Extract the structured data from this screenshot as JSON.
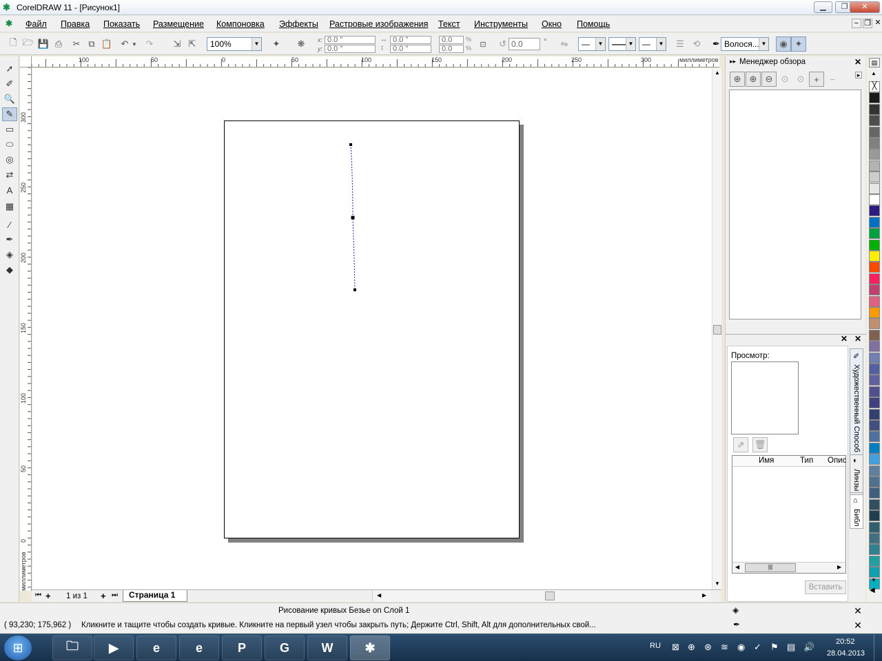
{
  "window": {
    "title": "CorelDRAW 11 - [Рисунок1]",
    "minimize": "▁",
    "restore": "❐",
    "close": "✕"
  },
  "menu": [
    "Файл",
    "Правка",
    "Показать",
    "Размещение",
    "Компоновка",
    "Эффекты",
    "Растровые изображения",
    "Текст",
    "Инструменты",
    "Окно",
    "Помощь"
  ],
  "toolbar": {
    "zoom": "100%",
    "x": "0.0 \"",
    "y": "0.0 \"",
    "w": "0.0 \"",
    "h": "0.0 \"",
    "scale_x": "0.0",
    "scale_y": "0.0",
    "pct1": "%",
    "pct2": "%",
    "rotation": "0.0",
    "degree": "°",
    "outline": "Волося...",
    "x_label": "x:",
    "y_label": "y:"
  },
  "rulers": {
    "h_labels": [
      "100",
      "50",
      "0",
      "50",
      "100",
      "150",
      "200",
      "250",
      "300"
    ],
    "h_unit": "миллиметров",
    "v_labels": [
      "300",
      "250",
      "200",
      "150",
      "100",
      "50",
      "0"
    ],
    "v_unit": "миллиметров"
  },
  "pages": {
    "counter": "1 из 1",
    "tab": "Страница 1"
  },
  "docker": {
    "view_manager_title": "Менеджер обзора",
    "preview_label": "Просмотр:",
    "columns": [
      "Имя",
      "Тип",
      "Опис"
    ],
    "insert_button": "Вставить",
    "side_tabs": [
      "Художественный Способ",
      "Линзы",
      "Библ"
    ]
  },
  "palette": {
    "colors": [
      "#ffffff",
      "#1a1a1a",
      "#333333",
      "#4d4d4d",
      "#666666",
      "#808080",
      "#999999",
      "#b3b3b3",
      "#cccccc",
      "#e6e6e6",
      "#ffffff",
      "#2e1a80",
      "#0070c0",
      "#00a040",
      "#00b000",
      "#ffee00",
      "#ff4a00",
      "#ff2060",
      "#c04070",
      "#e06080",
      "#ff9900",
      "#c09070",
      "#806050",
      "#8070a0",
      "#7080b0",
      "#5060a0",
      "#6060a0",
      "#505090",
      "#404080",
      "#304070",
      "#405080",
      "#5070a0",
      "#0080c0",
      "#40a0e0",
      "#6080a0",
      "#507090",
      "#406080",
      "#305060",
      "#204050",
      "#306070",
      "#407080",
      "#308090",
      "#20a0a0",
      "#10a0b0",
      "#00b0c0"
    ]
  },
  "status": {
    "line1": "Рисование кривых Безье on Слой 1",
    "coords": "( 93,230; 175,962 )",
    "hint": "Кликните и тащите чтобы создать кривые. Кликните на первый узел чтобы закрыть путь; Держите Ctrl, Shift, Alt для дополнительных свой..."
  },
  "taskbar": {
    "lang": "RU",
    "time": "20:52",
    "date": "28.04.2013",
    "apps": [
      "folder-icon",
      "media-player-icon",
      "internet-explorer-icon",
      "internet-explorer-icon",
      "publisher-icon",
      "google-icon",
      "word-icon",
      "coreldraw-icon"
    ]
  }
}
